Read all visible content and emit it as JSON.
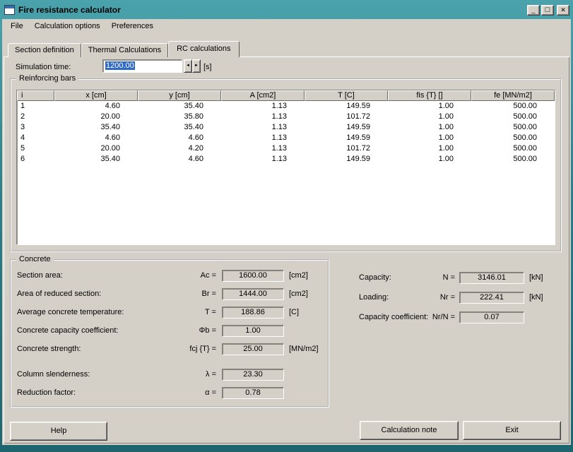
{
  "window": {
    "title": "Fire resistance calculator",
    "controls": {
      "minimize": "_",
      "maximize": "□",
      "close": "✕"
    }
  },
  "menu": {
    "items": [
      {
        "label": "File"
      },
      {
        "label": "Calculation options"
      },
      {
        "label": "Preferences"
      }
    ]
  },
  "tabs": [
    {
      "label": "Section definition"
    },
    {
      "label": "Thermal Calculations"
    },
    {
      "label": "RC calculations"
    }
  ],
  "simulation": {
    "label": "Simulation time:",
    "value": "1200.00",
    "unit": "[s]",
    "spin_left": "◄",
    "spin_right": "►"
  },
  "reinforcing": {
    "legend": "Reinforcing bars",
    "columns": [
      "i",
      "x [cm]",
      "y [cm]",
      "A [cm2]",
      "T [C]",
      "fis {T} []",
      "fe [MN/m2]"
    ],
    "rows": [
      [
        "1",
        "4.60",
        "35.40",
        "1.13",
        "149.59",
        "1.00",
        "500.00"
      ],
      [
        "2",
        "20.00",
        "35.80",
        "1.13",
        "101.72",
        "1.00",
        "500.00"
      ],
      [
        "3",
        "35.40",
        "35.40",
        "1.13",
        "149.59",
        "1.00",
        "500.00"
      ],
      [
        "4",
        "4.60",
        "4.60",
        "1.13",
        "149.59",
        "1.00",
        "500.00"
      ],
      [
        "5",
        "20.00",
        "4.20",
        "1.13",
        "101.72",
        "1.00",
        "500.00"
      ],
      [
        "6",
        "35.40",
        "4.60",
        "1.13",
        "149.59",
        "1.00",
        "500.00"
      ]
    ]
  },
  "concrete": {
    "legend": "Concrete",
    "rows": [
      {
        "label": "Section area:",
        "symbol": "Ac =",
        "value": "1600.00",
        "unit": "[cm2]"
      },
      {
        "label": "Area of reduced section:",
        "symbol": "Br =",
        "value": "1444.00",
        "unit": "[cm2]"
      },
      {
        "label": "Average concrete temperature:",
        "symbol": "T =",
        "value": "188.86",
        "unit": "[C]"
      },
      {
        "label": "Concrete capacity coefficient:",
        "symbol": "Φb =",
        "value": "1.00",
        "unit": ""
      },
      {
        "label": "Concrete strength:",
        "symbol": "fcj {T} =",
        "value": "25.00",
        "unit": "[MN/m2]"
      },
      {
        "label": "Column slenderness:",
        "symbol": "λ =",
        "value": "23.30",
        "unit": "",
        "gap_before": true
      },
      {
        "label": "Reduction factor:",
        "symbol": "α =",
        "value": "0.78",
        "unit": ""
      }
    ]
  },
  "results": {
    "rows": [
      {
        "label": "Capacity:",
        "symbol": "N =",
        "value": "3146.01",
        "unit": "[kN]"
      },
      {
        "label": "Loading:",
        "symbol": "Nr =",
        "value": "222.41",
        "unit": "[kN]"
      },
      {
        "label": "Capacity coefficient:",
        "symbol": "Nr/N =",
        "value": "0.07",
        "unit": ""
      }
    ]
  },
  "buttons": [
    {
      "label": "Help"
    },
    {
      "label": "Calculation note"
    },
    {
      "label": "Exit"
    }
  ],
  "colors": {
    "titlebar_teal": "#2b7e89",
    "face": "#d4d0c8",
    "selection": "#316ac5"
  }
}
